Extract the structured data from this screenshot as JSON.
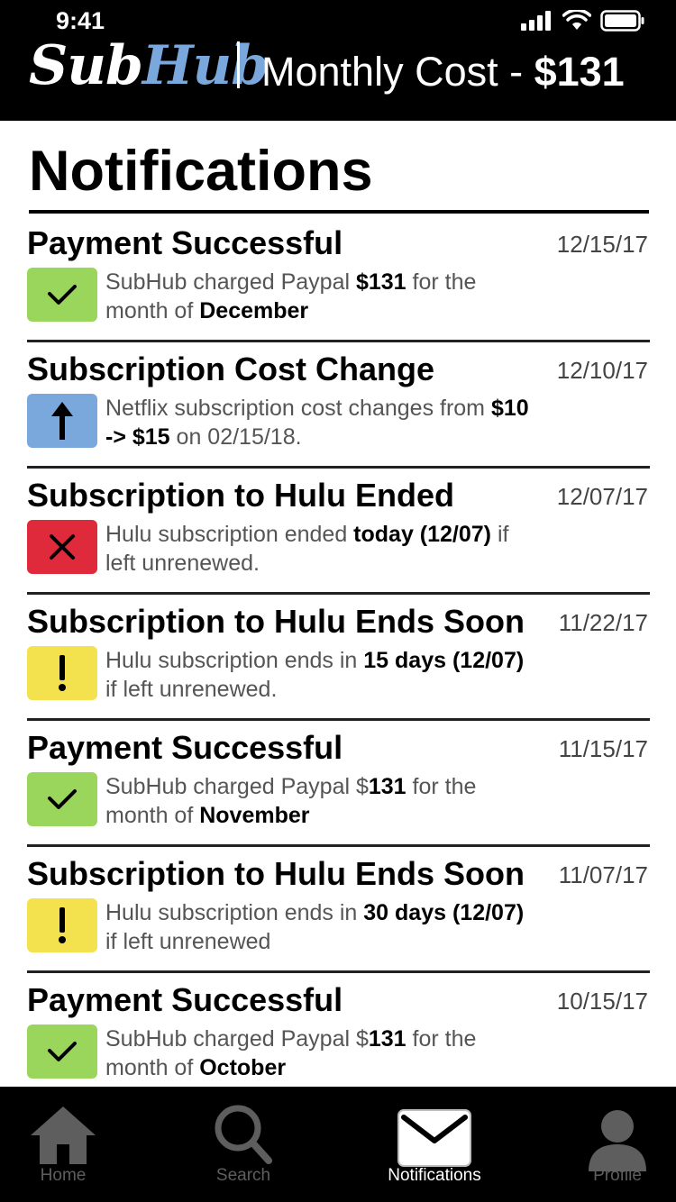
{
  "status": {
    "time": "9:41"
  },
  "header": {
    "logo_sub": "Sub",
    "logo_hub": "Hub",
    "monthly_label": "Monthly Cost - ",
    "monthly_value": "$131"
  },
  "page": {
    "title": "Notifications"
  },
  "colors": {
    "green": "#9bd65c",
    "blue": "#7aa7dc",
    "red": "#de2a3a",
    "yellow": "#f3e24e"
  },
  "notifications": [
    {
      "title": "Payment Successful",
      "date": "12/15/17",
      "icon": "check-icon",
      "t1": "SubHub charged Paypal ",
      "b1": "$131",
      "t2": " for the month of ",
      "b2": "December",
      "t3": ""
    },
    {
      "title": "Subscription Cost Change",
      "date": "12/10/17",
      "icon": "arrow-up-icon",
      "t1": "Netflix subscription cost changes from ",
      "b1": "$10 -> $15",
      "t2": " on 02/15/18.",
      "b2": "",
      "t3": ""
    },
    {
      "title": "Subscription to Hulu Ended",
      "date": "12/07/17",
      "icon": "x-icon",
      "t1": "Hulu subscription ended ",
      "b1": "today (12/07)",
      "t2": " if left unrenewed.",
      "b2": "",
      "t3": ""
    },
    {
      "title": "Subscription to Hulu Ends Soon",
      "date": "11/22/17",
      "icon": "exclamation-icon",
      "t1": "Hulu subscription ends in ",
      "b1": "15 days (12/07)",
      "t2": " if left unrenewed.",
      "b2": "",
      "t3": ""
    },
    {
      "title": "Payment Successful",
      "date": "11/15/17",
      "icon": "check-icon",
      "t1": "SubHub charged Paypal $",
      "b1": "131",
      "t2": " for the month of ",
      "b2": "November",
      "t3": ""
    },
    {
      "title": "Subscription to Hulu Ends Soon",
      "date": "11/07/17",
      "icon": "exclamation-icon",
      "t1": "Hulu subscription ends in ",
      "b1": "30 days (12/07)",
      "t2": " if left unrenewed",
      "b2": "",
      "t3": ""
    },
    {
      "title": "Payment Successful",
      "date": "10/15/17",
      "icon": "check-icon",
      "t1": "SubHub charged Paypal $",
      "b1": "131",
      "t2": " for the month of ",
      "b2": "October",
      "t3": ""
    }
  ],
  "tabs": [
    {
      "label": "Home",
      "icon": "home-icon",
      "active": false
    },
    {
      "label": "Search",
      "icon": "search-icon",
      "active": false
    },
    {
      "label": "Notifications",
      "icon": "envelope-icon",
      "active": true
    },
    {
      "label": "Profile",
      "icon": "profile-icon",
      "active": false
    }
  ]
}
